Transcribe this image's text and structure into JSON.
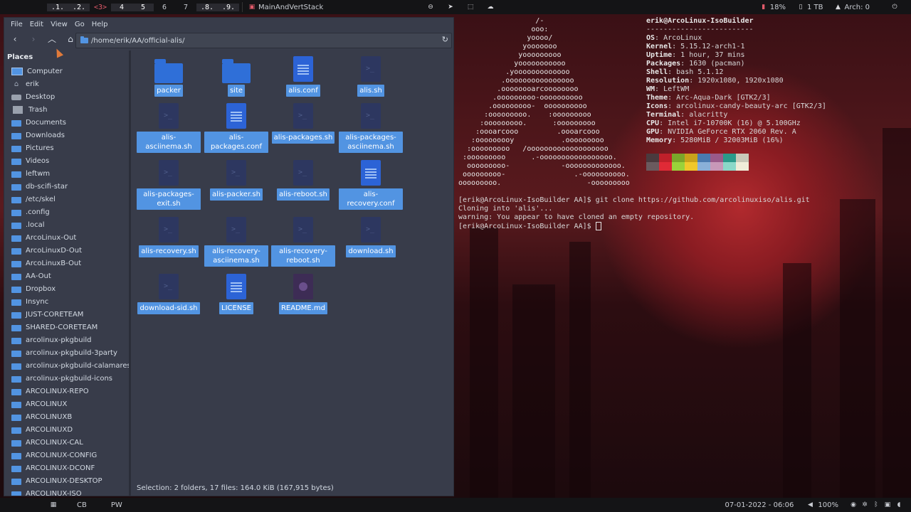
{
  "topbar": {
    "tags": [
      ".1.",
      ".2.",
      "<3>",
      "4",
      "5",
      "6",
      "7",
      ".8.",
      ".9."
    ],
    "active_tag": 2,
    "window_title": "MainAndVertStack",
    "disk_percent": "18%",
    "disk_size": "1 TB",
    "arch_label": "Arch: 0"
  },
  "file_manager": {
    "menu": [
      "File",
      "Edit",
      "View",
      "Go",
      "Help"
    ],
    "path": "/home/erik/AA/official-alis/",
    "places_title": "Places",
    "places": [
      {
        "label": "Computer",
        "icon": "computer-icon"
      },
      {
        "label": "erik",
        "icon": "home-icon"
      },
      {
        "label": "Desktop",
        "icon": "desktop-icon"
      },
      {
        "label": "Trash",
        "icon": "trash-icon"
      },
      {
        "label": "Documents",
        "icon": "folder-icon"
      },
      {
        "label": "Downloads",
        "icon": "folder-icon"
      },
      {
        "label": "Pictures",
        "icon": "folder-icon"
      },
      {
        "label": "Videos",
        "icon": "folder-icon"
      },
      {
        "label": "leftwm",
        "icon": "folder-icon"
      },
      {
        "label": "db-scifi-star",
        "icon": "folder-icon"
      },
      {
        "label": "/etc/skel",
        "icon": "folder-icon"
      },
      {
        "label": ".config",
        "icon": "folder-icon"
      },
      {
        "label": ".local",
        "icon": "folder-icon"
      },
      {
        "label": "ArcoLinux-Out",
        "icon": "folder-icon"
      },
      {
        "label": "ArcoLinuxD-Out",
        "icon": "folder-icon"
      },
      {
        "label": "ArcoLinuxB-Out",
        "icon": "folder-icon"
      },
      {
        "label": "AA-Out",
        "icon": "folder-icon"
      },
      {
        "label": "Dropbox",
        "icon": "folder-icon"
      },
      {
        "label": "Insync",
        "icon": "folder-icon"
      },
      {
        "label": "JUST-CORETEAM",
        "icon": "folder-icon"
      },
      {
        "label": "SHARED-CORETEAM",
        "icon": "folder-icon"
      },
      {
        "label": "arcolinux-pkgbuild",
        "icon": "folder-icon"
      },
      {
        "label": "arcolinux-pkgbuild-3party",
        "icon": "folder-icon"
      },
      {
        "label": "arcolinux-pkgbuild-calamares",
        "icon": "folder-icon"
      },
      {
        "label": "arcolinux-pkgbuild-icons",
        "icon": "folder-icon"
      },
      {
        "label": "ARCOLINUX-REPO",
        "icon": "folder-icon"
      },
      {
        "label": "ARCOLINUX",
        "icon": "folder-icon"
      },
      {
        "label": "ARCOLINUXB",
        "icon": "folder-icon"
      },
      {
        "label": "ARCOLINUXD",
        "icon": "folder-icon"
      },
      {
        "label": "ARCOLINUX-CAL",
        "icon": "folder-icon"
      },
      {
        "label": "ARCOLINUX-CONFIG",
        "icon": "folder-icon"
      },
      {
        "label": "ARCOLINUX-DCONF",
        "icon": "folder-icon"
      },
      {
        "label": "ARCOLINUX-DESKTOP",
        "icon": "folder-icon"
      },
      {
        "label": "ARCOLINUX-ISO",
        "icon": "folder-icon"
      }
    ],
    "files": [
      {
        "name": "packer",
        "type": "folder"
      },
      {
        "name": "site",
        "type": "folder"
      },
      {
        "name": "alis.conf",
        "type": "doc"
      },
      {
        "name": "alis.sh",
        "type": "script"
      },
      {
        "name": "alis-asciinema.sh",
        "type": "script"
      },
      {
        "name": "alis-packages.conf",
        "type": "doc"
      },
      {
        "name": "alis-packages.sh",
        "type": "script"
      },
      {
        "name": "alis-packages-asciinema.sh",
        "type": "script"
      },
      {
        "name": "alis-packages-exit.sh",
        "type": "script"
      },
      {
        "name": "alis-packer.sh",
        "type": "script"
      },
      {
        "name": "alis-reboot.sh",
        "type": "script"
      },
      {
        "name": "alis-recovery.conf",
        "type": "doc"
      },
      {
        "name": "alis-recovery.sh",
        "type": "script"
      },
      {
        "name": "alis-recovery-asciinema.sh",
        "type": "script"
      },
      {
        "name": "alis-recovery-reboot.sh",
        "type": "script"
      },
      {
        "name": "download.sh",
        "type": "script"
      },
      {
        "name": "download-sid.sh",
        "type": "script"
      },
      {
        "name": "LICENSE",
        "type": "doc"
      },
      {
        "name": "README.md",
        "type": "md"
      }
    ],
    "status": "Selection: 2 folders, 17 files: 164.0 KiB (167,915 bytes)"
  },
  "terminal": {
    "logo": [
      "                  /-",
      "                 ooo:",
      "                yoooo/",
      "               yooooooo",
      "              yooooooooo",
      "             yooooooooooo",
      "           .yooooooooooooo",
      "          .oooooooooooooooo",
      "         .oooooooarcoooooooo",
      "        .ooooooooo-oooooooooo",
      "       .ooooooooo-  oooooooooo",
      "      :ooooooooo.    :ooooooooo",
      "     :ooooooooo.      :ooooooooo",
      "    :oooarcooo         .oooarcooo",
      "   :ooooooooy           .ooooooooo",
      "  :ooooooooo   /ooooooooooooooooooo",
      " :ooooooooo      .-ooooooooooooooooo.",
      "  ooooooooo-            -ooooooooooooo.",
      " ooooooooo-                .-oooooooooo.",
      "ooooooooo.                    -ooooooooo"
    ],
    "user_host": "erik@ArcoLinux-IsoBuilder",
    "divider": "-------------------------",
    "info": [
      {
        "key": "OS",
        "value": "ArcoLinux"
      },
      {
        "key": "Kernel",
        "value": "5.15.12-arch1-1"
      },
      {
        "key": "Uptime",
        "value": "1 hour, 37 mins"
      },
      {
        "key": "Packages",
        "value": "1630 (pacman)"
      },
      {
        "key": "Shell",
        "value": "bash 5.1.12"
      },
      {
        "key": "Resolution",
        "value": "1920x1080, 1920x1080"
      },
      {
        "key": "WM",
        "value": "LeftWM"
      },
      {
        "key": "Theme",
        "value": "Arc-Aqua-Dark [GTK2/3]"
      },
      {
        "key": "Icons",
        "value": "arcolinux-candy-beauty-arc [GTK2/3]"
      },
      {
        "key": "Terminal",
        "value": "alacritty"
      },
      {
        "key": "CPU",
        "value": "Intel i7-10700K (16) @ 5.100GHz"
      },
      {
        "key": "GPU",
        "value": "NVIDIA GeForce RTX 2060 Rev. A"
      },
      {
        "key": "Memory",
        "value": "5280MiB / 32003MiB (16%)"
      }
    ],
    "palette_top": [
      "#4a3a3e",
      "#c0202a",
      "#7aa62a",
      "#c9a21a",
      "#4a7ab0",
      "#9a5a8a",
      "#2a9a8a",
      "#c8c8b8"
    ],
    "palette_bottom": [
      "#6a5a5e",
      "#e02a36",
      "#9ad23a",
      "#f0c82a",
      "#8ab0d8",
      "#c898b8",
      "#8ad8c8",
      "#f0ecd8"
    ],
    "lines": [
      "[erik@ArcoLinux-IsoBuilder AA]$ git clone https://github.com/arcolinuxiso/alis.git",
      "Cloning into 'alis'...",
      "warning: You appear to have cloned an empty repository.",
      "[erik@ArcoLinux-IsoBuilder AA]$ "
    ]
  },
  "bottombar": {
    "left_items": [
      "CB",
      "PW"
    ],
    "datetime": "07-01-2022 - 06:06",
    "volume": "100%"
  }
}
